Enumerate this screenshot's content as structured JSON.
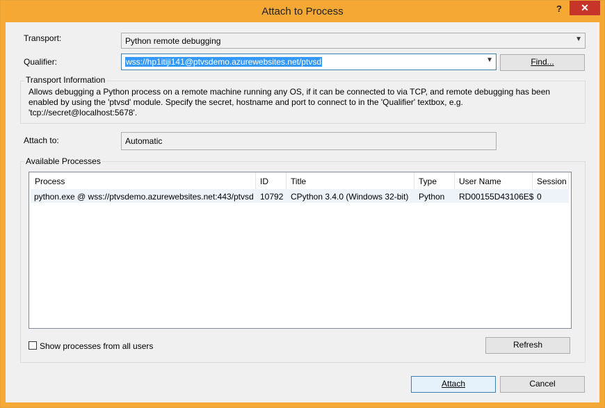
{
  "window": {
    "title": "Attach to Process",
    "help_label": "?",
    "close_label": "✕"
  },
  "transport": {
    "label": "Transport:",
    "value": "Python remote debugging"
  },
  "qualifier": {
    "label": "Qualifier:",
    "value": "wss://hp1itiji141@ptvsdemo.azurewebsites.net/ptvsd",
    "find_label": "Find..."
  },
  "transport_info": {
    "title": "Transport Information",
    "text": "Allows debugging a Python process on a remote machine running any OS, if it can be connected to via TCP, and remote debugging has been enabled by using the 'ptvsd' module. Specify the secret, hostname and port to connect to in the 'Qualifier' textbox, e.g. 'tcp://secret@localhost:5678'."
  },
  "attach_to": {
    "label": "Attach to:",
    "value": "Automatic"
  },
  "processes": {
    "title": "Available Processes",
    "columns": [
      "Process",
      "ID",
      "Title",
      "Type",
      "User Name",
      "Session"
    ],
    "rows": [
      [
        "python.exe @ wss://ptvsdemo.azurewebsites.net:443/ptvsd",
        "10792",
        "CPython 3.4.0 (Windows 32-bit)",
        "Python",
        "RD00155D43106E$",
        "0"
      ]
    ],
    "show_all_label": "Show processes from all users",
    "show_all_checked": false,
    "refresh_label": "Refresh"
  },
  "footer": {
    "attach_label": "Attach",
    "cancel_label": "Cancel"
  },
  "colors": {
    "title_bar": "#f5a833",
    "close_button": "#c7352a",
    "selection": "#3399ff",
    "row_highlight": "#eef3fa"
  }
}
